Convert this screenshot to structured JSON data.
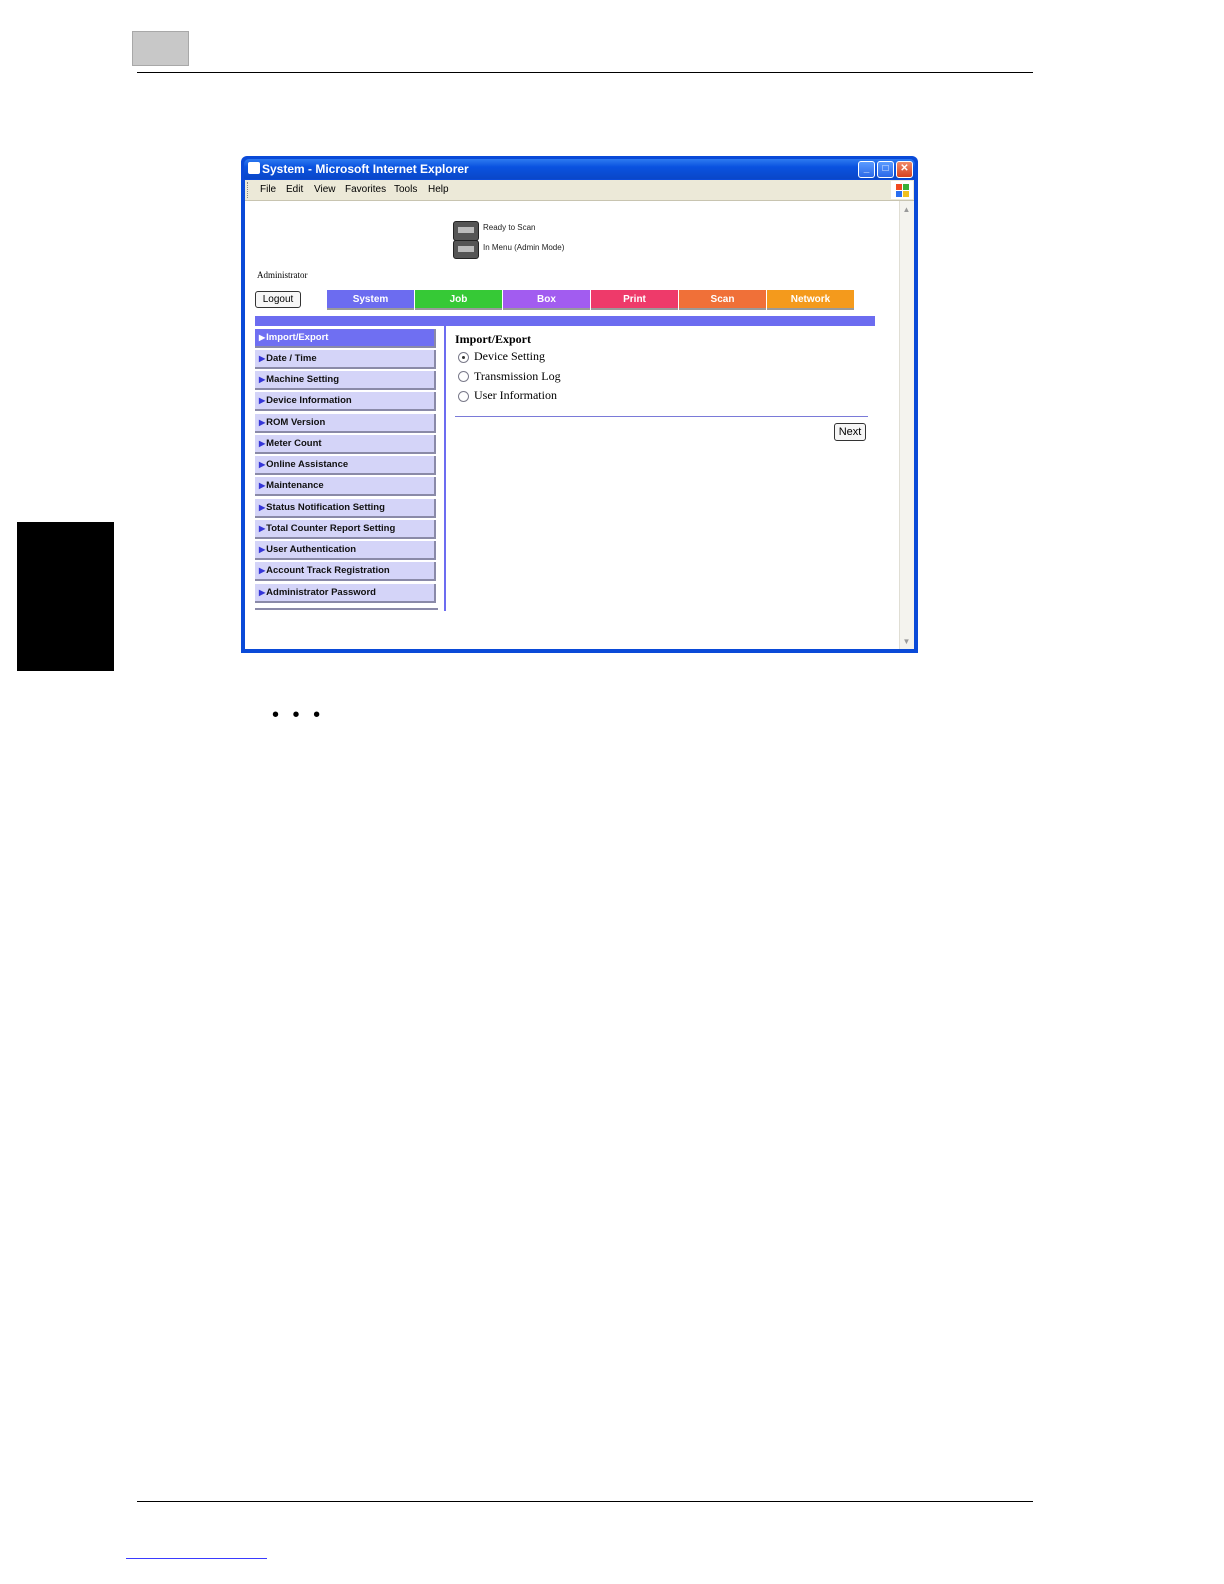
{
  "window": {
    "title": "System - Microsoft Internet Explorer",
    "buttons": {
      "minimize": "_",
      "maximize": "□",
      "close": "✕"
    }
  },
  "menu": [
    "File",
    "Edit",
    "View",
    "Favorites",
    "Tools",
    "Help"
  ],
  "status": {
    "scan": "Ready to Scan",
    "mode": "In Menu (Admin Mode)"
  },
  "user": {
    "role": "Administrator",
    "logout_label": "Logout"
  },
  "tabs": [
    {
      "label": "System",
      "color": "#6c6cf0"
    },
    {
      "label": "Job",
      "color": "#36c936"
    },
    {
      "label": "Box",
      "color": "#a25cf0"
    },
    {
      "label": "Print",
      "color": "#ee3a6a"
    },
    {
      "label": "Scan",
      "color": "#f07038"
    },
    {
      "label": "Network",
      "color": "#f49a1c"
    }
  ],
  "sidebar": {
    "items": [
      {
        "label": "Import/Export",
        "active": true
      },
      {
        "label": "Date / Time"
      },
      {
        "label": "Machine Setting"
      },
      {
        "label": "Device Information"
      },
      {
        "label": "ROM Version"
      },
      {
        "label": "Meter Count"
      },
      {
        "label": "Online Assistance"
      },
      {
        "label": "Maintenance"
      },
      {
        "label": "Status Notification Setting"
      },
      {
        "label": "Total Counter Report Setting"
      },
      {
        "label": "User Authentication"
      },
      {
        "label": "Account Track Registration"
      },
      {
        "label": "Administrator Password"
      }
    ]
  },
  "main": {
    "title": "Import/Export",
    "options": [
      {
        "label": "Device Setting",
        "checked": true
      },
      {
        "label": "Transmission Log",
        "checked": false
      },
      {
        "label": "User Information",
        "checked": false
      }
    ],
    "next_label": "Next"
  },
  "page": {
    "ellipsis": "• • •"
  },
  "icons": {
    "status_scanner": "scanner-icon",
    "status_printer": "printer-icon",
    "title": "ie-icon",
    "logo": "windows-logo-icon",
    "nav_arrow": "triangle-right-icon"
  }
}
